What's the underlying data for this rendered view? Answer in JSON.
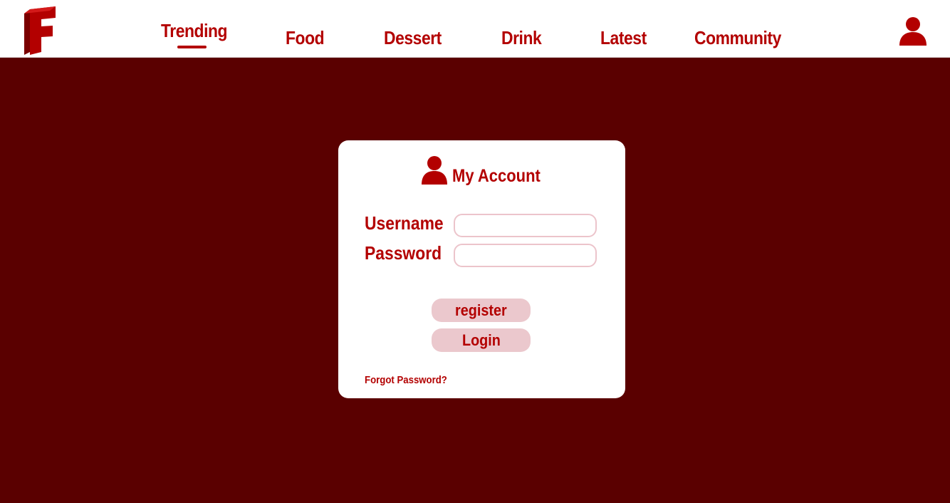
{
  "nav": {
    "items": [
      {
        "label": "Trending",
        "active": true
      },
      {
        "label": "Food"
      },
      {
        "label": "Dessert"
      },
      {
        "label": "Drink"
      },
      {
        "label": "Latest"
      },
      {
        "label": "Community"
      }
    ]
  },
  "icons": {
    "logo": "logo-f-icon",
    "account": "user-icon"
  },
  "login": {
    "title": "My Account",
    "username_label": "Username",
    "username_value": "",
    "password_label": "Password",
    "password_value": "",
    "register_label": "register",
    "login_label": "Login",
    "forgot_label": "Forgot Password?"
  },
  "colors": {
    "brand": "#b30000",
    "background": "#5a0000",
    "button": "#ebc8cd",
    "input_border": "#ecc4cb"
  }
}
